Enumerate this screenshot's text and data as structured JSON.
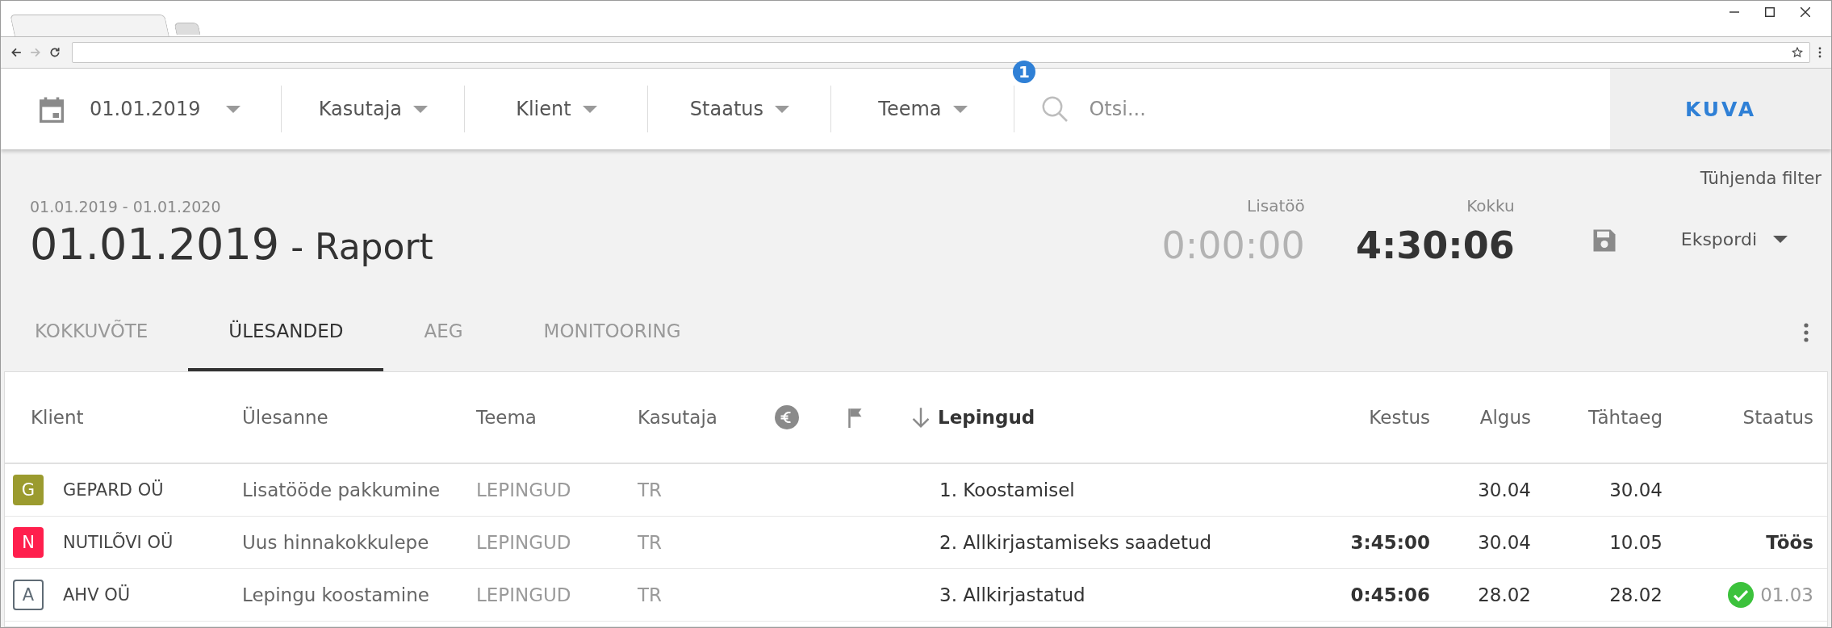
{
  "browser": {
    "tabs": [
      {
        "selected": true
      },
      {
        "selected": false
      }
    ]
  },
  "filters": {
    "date": "01.01.2019",
    "dropdowns": [
      {
        "label": "Kasutaja"
      },
      {
        "label": "Klient"
      },
      {
        "label": "Staatus"
      },
      {
        "label": "Teema",
        "badge": "1"
      }
    ],
    "search": {
      "placeholder": "Otsi..."
    },
    "button": "KUVA"
  },
  "report": {
    "clear_filter": "Tühjenda filter",
    "range": "01.01.2019 - 01.01.2020",
    "title_date": "01.01.2019",
    "title_suffix": "- Raport",
    "stats": [
      {
        "label": "Lisatöö",
        "value": "0:00:00",
        "kind": "muted"
      },
      {
        "label": "Kokku",
        "value": "4:30:06",
        "kind": "total"
      }
    ],
    "export": "Ekspordi"
  },
  "tabs": [
    {
      "label": "KOKKUVÕTE",
      "selected": false
    },
    {
      "label": "ÜLESANDED",
      "selected": true
    },
    {
      "label": "AEG",
      "selected": false
    },
    {
      "label": "MONITOORING",
      "selected": false
    }
  ],
  "table": {
    "columns": [
      {
        "kind": "text",
        "label": "Klient",
        "sorted": false
      },
      {
        "kind": "text",
        "label": "Ülesanne",
        "sorted": false
      },
      {
        "kind": "text",
        "label": "Teema",
        "sorted": false
      },
      {
        "kind": "text",
        "label": "Kasutaja",
        "sorted": false
      },
      {
        "kind": "euro"
      },
      {
        "kind": "flag"
      },
      {
        "kind": "text",
        "label": "Lepingud",
        "sorted": true
      },
      {
        "kind": "text",
        "label": "Kestus",
        "sorted": false
      },
      {
        "kind": "text",
        "label": "Algus",
        "sorted": false
      },
      {
        "kind": "text",
        "label": "Tähtaeg",
        "sorted": false
      },
      {
        "kind": "text",
        "label": "Staatus",
        "sorted": false
      }
    ],
    "rows": [
      {
        "client": {
          "initial": "G",
          "name": "GEPARD OÜ",
          "color": "#9b9b2f",
          "kind": "filled"
        },
        "task": "Lisatööde pakkumine",
        "theme": "LEPINGUD",
        "user": "TR",
        "contract": "1. Koostamisel",
        "start": "30.04",
        "deadline": "30.04"
      },
      {
        "client": {
          "initial": "N",
          "name": "NUTILÕVI OÜ",
          "color": "#ff1f4d",
          "kind": "filled"
        },
        "task": "Uus hinnakokkulepe",
        "theme": "LEPINGUD",
        "user": "TR",
        "contract": "2. Allkirjastamiseks saadetud",
        "duration": "3:45:00",
        "start": "30.04",
        "deadline": "10.05",
        "status": {
          "kind": "text",
          "text": "Töös"
        }
      },
      {
        "client": {
          "initial": "A",
          "name": "AHV OÜ",
          "color": "#5f6b75",
          "kind": "outline"
        },
        "task": "Lepingu koostamine",
        "theme": "LEPINGUD",
        "user": "TR",
        "contract": "3. Allkirjastatud",
        "duration": "0:45:06",
        "start": "28.02",
        "deadline": "28.02",
        "status": {
          "kind": "done",
          "text": "01.03"
        }
      }
    ]
  }
}
